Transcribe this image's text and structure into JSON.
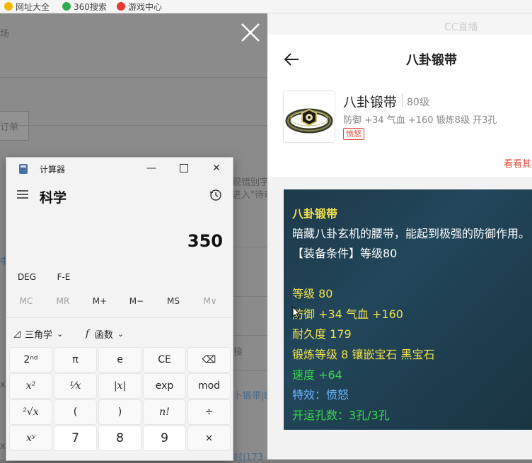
{
  "bookmarks": [
    {
      "label": "网址大全",
      "color": "#f2b705"
    },
    {
      "label": "360搜索",
      "color": "#2eae4f"
    },
    {
      "label": "游戏中心",
      "color": "#e53935"
    }
  ],
  "background_page": {
    "frag_top": "场",
    "frag_tab": "订单",
    "frag_right_1": "现错别字",
    "frag_right_2": "进入\"待审",
    "frag_right_3": "接",
    "frag_right_4": "卜锻带|80",
    "frag_right_5": "村|173",
    "frag_left_1": "中",
    "frag_left_2": "xy"
  },
  "panel": {
    "watermark": "CC直播",
    "title": "八卦锻带",
    "item_name": "八卦锻带",
    "item_level": "80级",
    "item_attr": "防御 +34 气血 +160 锻炼8级 开3孔",
    "item_tag": "愤怒",
    "see_more": "看看其",
    "desc": {
      "name": "八卦锻带",
      "flavor": "暗藏八卦玄机的腰带，能起到极强的防御作用。",
      "requirement": "【装备条件】等级80",
      "level": "等级 80",
      "defense": "防御 +34 气血 +160",
      "durability": "耐久度 179",
      "forge": "锻炼等级 8 镶嵌宝石 黑宝石",
      "speed": "速度 +64",
      "special": "特效：愤怒",
      "holes": "开运孔数：3孔/3孔"
    },
    "colors": {
      "yellow": "#f2e04b",
      "white": "#ffffff",
      "green": "#35d94a",
      "blue": "#66b5ff",
      "tag_red": "#e24a3b"
    }
  },
  "calculator": {
    "window_title": "计算器",
    "mode": "科学",
    "display": "350",
    "angle_unit": "DEG",
    "fe": "F-E",
    "memory": [
      "MC",
      "MR",
      "M+",
      "M−",
      "MS",
      "M∨"
    ],
    "trig_label": "三角学",
    "func_label": "函数",
    "keys": [
      [
        "2ⁿᵈ",
        "π",
        "e",
        "CE",
        "⌫"
      ],
      [
        "x²",
        "¹⁄x",
        "|x|",
        "exp",
        "mod"
      ],
      [
        "²√x",
        "(",
        ")",
        "n!",
        "÷"
      ],
      [
        "xʸ",
        "7",
        "8",
        "9",
        "×"
      ]
    ]
  }
}
